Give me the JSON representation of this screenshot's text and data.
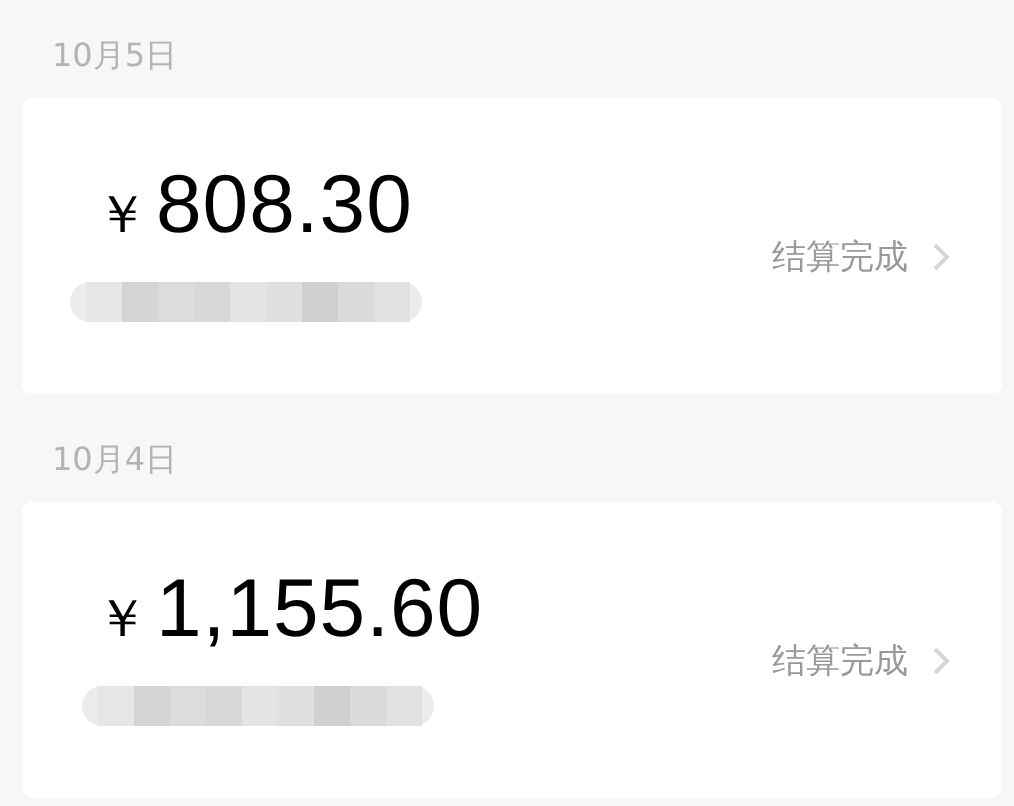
{
  "days": [
    {
      "date": "10月5日",
      "entries": [
        {
          "currency": "￥",
          "amount": "808.30",
          "status": "结算完成"
        }
      ]
    },
    {
      "date": "10月4日",
      "entries": [
        {
          "currency": "￥",
          "amount": "1,155.60",
          "status": "结算完成"
        }
      ]
    }
  ]
}
